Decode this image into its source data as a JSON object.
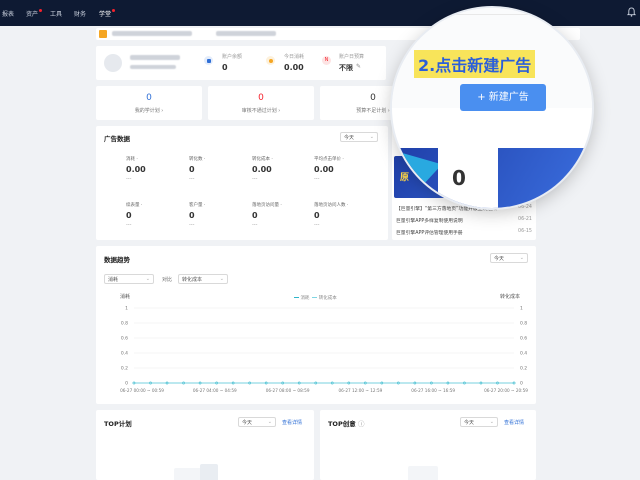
{
  "topbar": {
    "nav": [
      "报表",
      "资产",
      "工具",
      "财务",
      "学堂"
    ],
    "badges": [
      "资产",
      "学堂"
    ]
  },
  "account": {
    "balance_label": "账户余额",
    "balance_value": "0",
    "today_label": "今日消耗",
    "today_value": "0.00",
    "budget_label": "账户日预算",
    "budget_value": "不限"
  },
  "stats": [
    {
      "value": "0",
      "label": "我的学计划",
      "color": "#2f6fd6"
    },
    {
      "value": "0",
      "label": "审核不通过计划",
      "color": "#f5222d"
    },
    {
      "value": "0",
      "label": "预算不足计划",
      "color": "#333333"
    }
  ],
  "ad_data": {
    "title": "广告数据",
    "period": "今天",
    "metrics": [
      {
        "label": "消耗",
        "value": "0.00",
        "delta": "---"
      },
      {
        "label": "转化数",
        "value": "0",
        "delta": "---"
      },
      {
        "label": "转化成本",
        "value": "0.00",
        "delta": "---"
      },
      {
        "label": "平均点击单价",
        "value": "0.00",
        "delta": "---"
      },
      {
        "label": "续表量",
        "value": "0",
        "delta": "---"
      },
      {
        "label": "客户量",
        "value": "0",
        "delta": "---"
      },
      {
        "label": "落地页访问量",
        "value": "0",
        "delta": "---"
      },
      {
        "label": "落地页访问人数",
        "value": "0",
        "delta": "---"
      }
    ]
  },
  "magnifier": {
    "highlight": "2.点击新建广告",
    "button": "+ 新建广告"
  },
  "banner_value": "0",
  "news": [
    {
      "title": "【巨量引擎】“第三方落地页”功能升级上线通知",
      "date": "06-24"
    },
    {
      "title": "巨量引擎APP多样复制使用说明",
      "date": "06-21"
    },
    {
      "title": "巨量引擎APP评估管理使用手册",
      "date": "06-15"
    }
  ],
  "trend": {
    "title": "数据趋势",
    "period": "今天",
    "metric1": "消耗",
    "compare_label": "对比",
    "metric2": "转化成本",
    "legend": [
      "消耗",
      "转化成本"
    ],
    "left_axis_label": "消耗",
    "right_axis_label": "转化成本"
  },
  "chart_data": {
    "type": "line",
    "x": [
      "06-27 00:00 ~ 00:59",
      "06-27 04:00 ~ 04:59",
      "06-27 08:00 ~ 08:59",
      "06-27 12:00 ~ 12:59",
      "06-27 16:00 ~ 16:59",
      "06-27 20:00 ~ 20:59"
    ],
    "y_ticks": [
      "1",
      "0.8",
      "0.6",
      "0.4",
      "0.2",
      "0"
    ],
    "ylim": [
      0,
      1
    ],
    "series": [
      {
        "name": "消耗",
        "values": [
          0,
          0,
          0,
          0,
          0,
          0,
          0,
          0,
          0,
          0,
          0,
          0,
          0,
          0,
          0,
          0,
          0,
          0,
          0,
          0,
          0,
          0,
          0,
          0
        ]
      },
      {
        "name": "转化成本",
        "values": [
          0,
          0,
          0,
          0,
          0,
          0,
          0,
          0,
          0,
          0,
          0,
          0,
          0,
          0,
          0,
          0,
          0,
          0,
          0,
          0,
          0,
          0,
          0,
          0
        ]
      }
    ],
    "colors": [
      "#2fb5c9",
      "#7fd6e3"
    ]
  },
  "top_plan": {
    "title": "TOP计划",
    "period": "今天",
    "link": "查看详情"
  },
  "top_creative": {
    "title": "TOP创意",
    "period": "今天",
    "link": "查看详情"
  }
}
